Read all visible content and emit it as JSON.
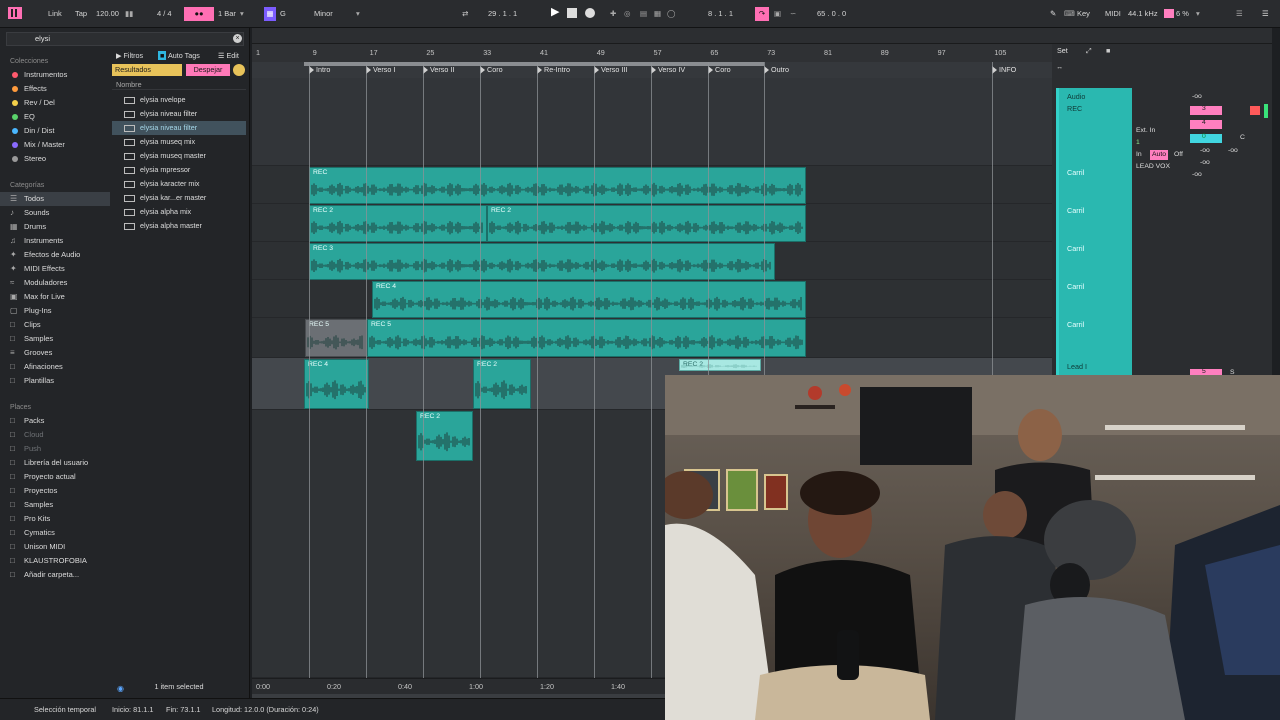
{
  "topbar": {
    "link": "Link",
    "tap": "Tap",
    "tempo": "120.00",
    "signature": "4 / 4",
    "quant": "1 Bar",
    "key_root": "G",
    "key_scale": "Minor",
    "position": "29 .   1 .   1",
    "loop_start": "8 .   1 .   1",
    "loop_length": "65 .   0 .   0",
    "key_label": "Key",
    "midi_label": "MIDI",
    "sample_rate": "44.1 kHz",
    "cpu": "6 %"
  },
  "browser": {
    "search_value": "elysi",
    "collections_header": "Colecciones",
    "collections": [
      {
        "label": "Instrumentos",
        "color": "#ff5a6e"
      },
      {
        "label": "Effects",
        "color": "#ff9b3d"
      },
      {
        "label": "Rev / Del",
        "color": "#f3d04a"
      },
      {
        "label": "EQ",
        "color": "#5ad36b"
      },
      {
        "label": "Din / Dist",
        "color": "#4ab7ff"
      },
      {
        "label": "Mix / Master",
        "color": "#8a6bff"
      },
      {
        "label": "Stereo",
        "color": "#9a9a9a"
      }
    ],
    "categories_header": "Categorías",
    "categories": [
      "Todos",
      "Sounds",
      "Drums",
      "Instruments",
      "Efectos de Audio",
      "MIDI Effects",
      "Moduladores",
      "Max for Live",
      "Plug-Ins",
      "Clips",
      "Samples",
      "Grooves",
      "Afinaciones",
      "Plantillas"
    ],
    "places_header": "Places",
    "places": [
      "Packs",
      "Cloud",
      "Push",
      "Librería del usuario",
      "Proyecto actual",
      "Proyectos",
      "Samples",
      "Pro Kits",
      "Cymatics",
      "Unison MIDI",
      "KLAUSTROFOBIA",
      "Añadir carpeta..."
    ],
    "tabs": {
      "filters": "Filtros",
      "auto_tags": "Auto Tags",
      "edit": "Edit"
    },
    "results_label": "Resultados",
    "clear_label": "Despejar",
    "name_header": "Nombre",
    "files": [
      "elysia nvelope",
      "elysia niveau filter",
      "elysia niveau filter",
      "elysia museq mix",
      "elysia museq master",
      "elysia mpressor",
      "elysia karacter mix",
      "elysia kar...er master",
      "elysia alpha mix",
      "elysia alpha master"
    ],
    "footer": "1 item selected"
  },
  "arrangement": {
    "bars": [
      "1",
      "9",
      "17",
      "25",
      "33",
      "41",
      "49",
      "57",
      "65",
      "73",
      "81",
      "89",
      "97",
      "105"
    ],
    "locators": [
      "Intro",
      "Verso I",
      "Verso II",
      "Coro",
      "Re-Intro",
      "Verso III",
      "Verso IV",
      "Coro",
      "Outro",
      "INFO"
    ],
    "clips": [
      "REC",
      "REC 2",
      "REC 2",
      "REC 3",
      "REC 4",
      "REC 5",
      "REC 5",
      "REC 4",
      "REC 2",
      "REC 2",
      "REC 2"
    ],
    "times": [
      "0:00",
      "0:20",
      "0:40",
      "1:00",
      "1:20",
      "1:40"
    ]
  },
  "mixer": {
    "set_label": "Set",
    "audio_label": "Audio",
    "rec_label": "REC",
    "ext_in": "Ext. In",
    "input_ch": "1",
    "monitor_in": "In",
    "monitor_auto": "Auto",
    "monitor_off": "Off",
    "output": "LEAD VOX",
    "returns": [
      "Carril",
      "Carril",
      "Carril",
      "Carril",
      "Carril"
    ],
    "lead": "Lead I",
    "values": [
      "-oo",
      "3",
      "4",
      "0",
      "C",
      "-oo",
      "-oo",
      "-oo",
      "-oo",
      "5",
      "S"
    ]
  },
  "status": {
    "mode": "Selección temporal",
    "start": "Inicio: 81.1.1",
    "end": "Fin: 73.1.1",
    "length": "Longitud: 12.0.0 (Duración: 0:24)"
  }
}
